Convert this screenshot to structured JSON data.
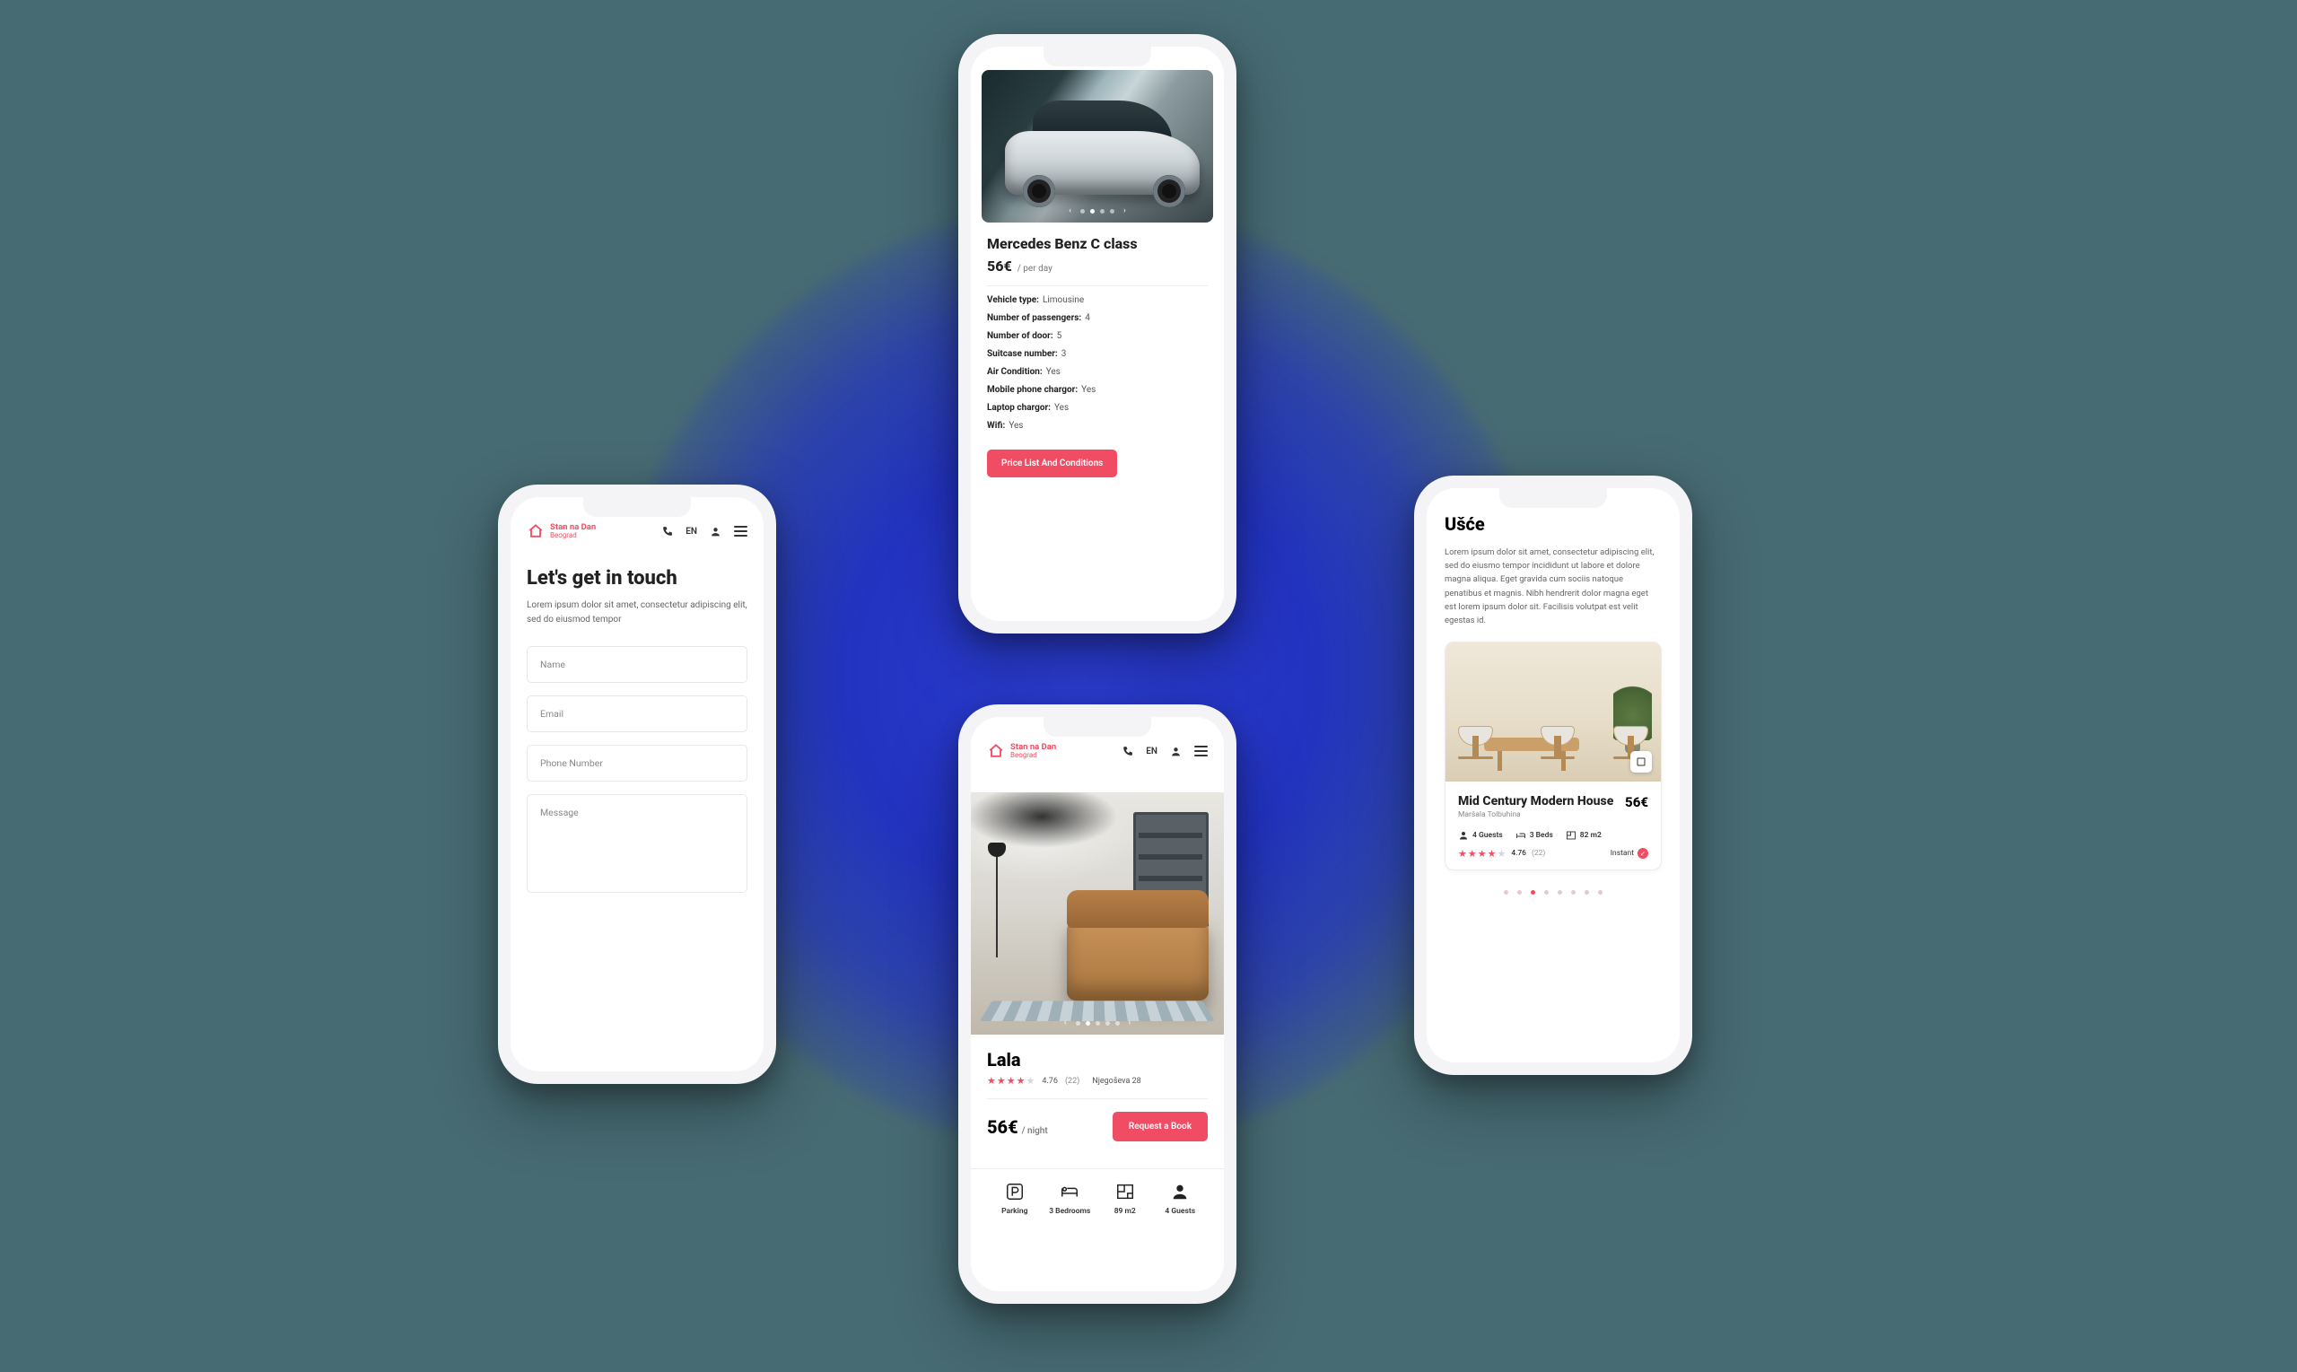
{
  "brand": {
    "name": "Stan na Dan",
    "sub": "Beograd",
    "lang": "EN"
  },
  "contact": {
    "heading": "Let's get in touch",
    "lead": "Lorem ipsum dolor sit amet, consectetur adipiscing elit, sed do eiusmod tempor",
    "fields": {
      "name": "Name",
      "email": "Email",
      "phone": "Phone Number",
      "message": "Message"
    }
  },
  "car": {
    "title": "Mercedes Benz  C class",
    "price": "56€",
    "per": "/ per day",
    "specs": [
      {
        "k": "Vehicle type:",
        "v": "Limousine"
      },
      {
        "k": "Number of passengers:",
        "v": "4"
      },
      {
        "k": "Number of door:",
        "v": "5"
      },
      {
        "k": "Suitcase number:",
        "v": "3"
      },
      {
        "k": "Air Condition:",
        "v": "Yes"
      },
      {
        "k": "Mobile phone chargor:",
        "v": "Yes"
      },
      {
        "k": "Laptop  chargor:",
        "v": "Yes"
      },
      {
        "k": "Wifi:",
        "v": "Yes"
      }
    ],
    "cta": "Price List And Conditions"
  },
  "listing": {
    "title": "Lala",
    "rating_value": "4.76",
    "rating_count": "(22)",
    "address": "Njegoševa 28",
    "price": "56€",
    "per": "/ night",
    "cta": "Request a Book",
    "features": [
      {
        "label": "Parking"
      },
      {
        "label": "3 Bedrooms"
      },
      {
        "label": "89 m2"
      },
      {
        "label": "4 Guests"
      }
    ]
  },
  "usce": {
    "heading": "Ušće",
    "para": "Lorem ipsum dolor sit amet, consectetur adipiscing elit, sed do eiusmo tempor incididunt ut labore et dolore magna aliqua. Eget gravida cum sociis natoque penatibus et magnis. Nibh hendrerit dolor magna eget est lorem ipsum dolor sit. Facilisis volutpat est velit egestas id.",
    "card": {
      "title": "Mid Century Modern House",
      "price": "56€",
      "sub": "Maršala Tolbuhina",
      "badges": {
        "guests": "4 Guests",
        "beds": "3 Beds",
        "area": "82 m2"
      },
      "rating_value": "4.76",
      "rating_count": "(22)",
      "instant": "Instant"
    }
  }
}
